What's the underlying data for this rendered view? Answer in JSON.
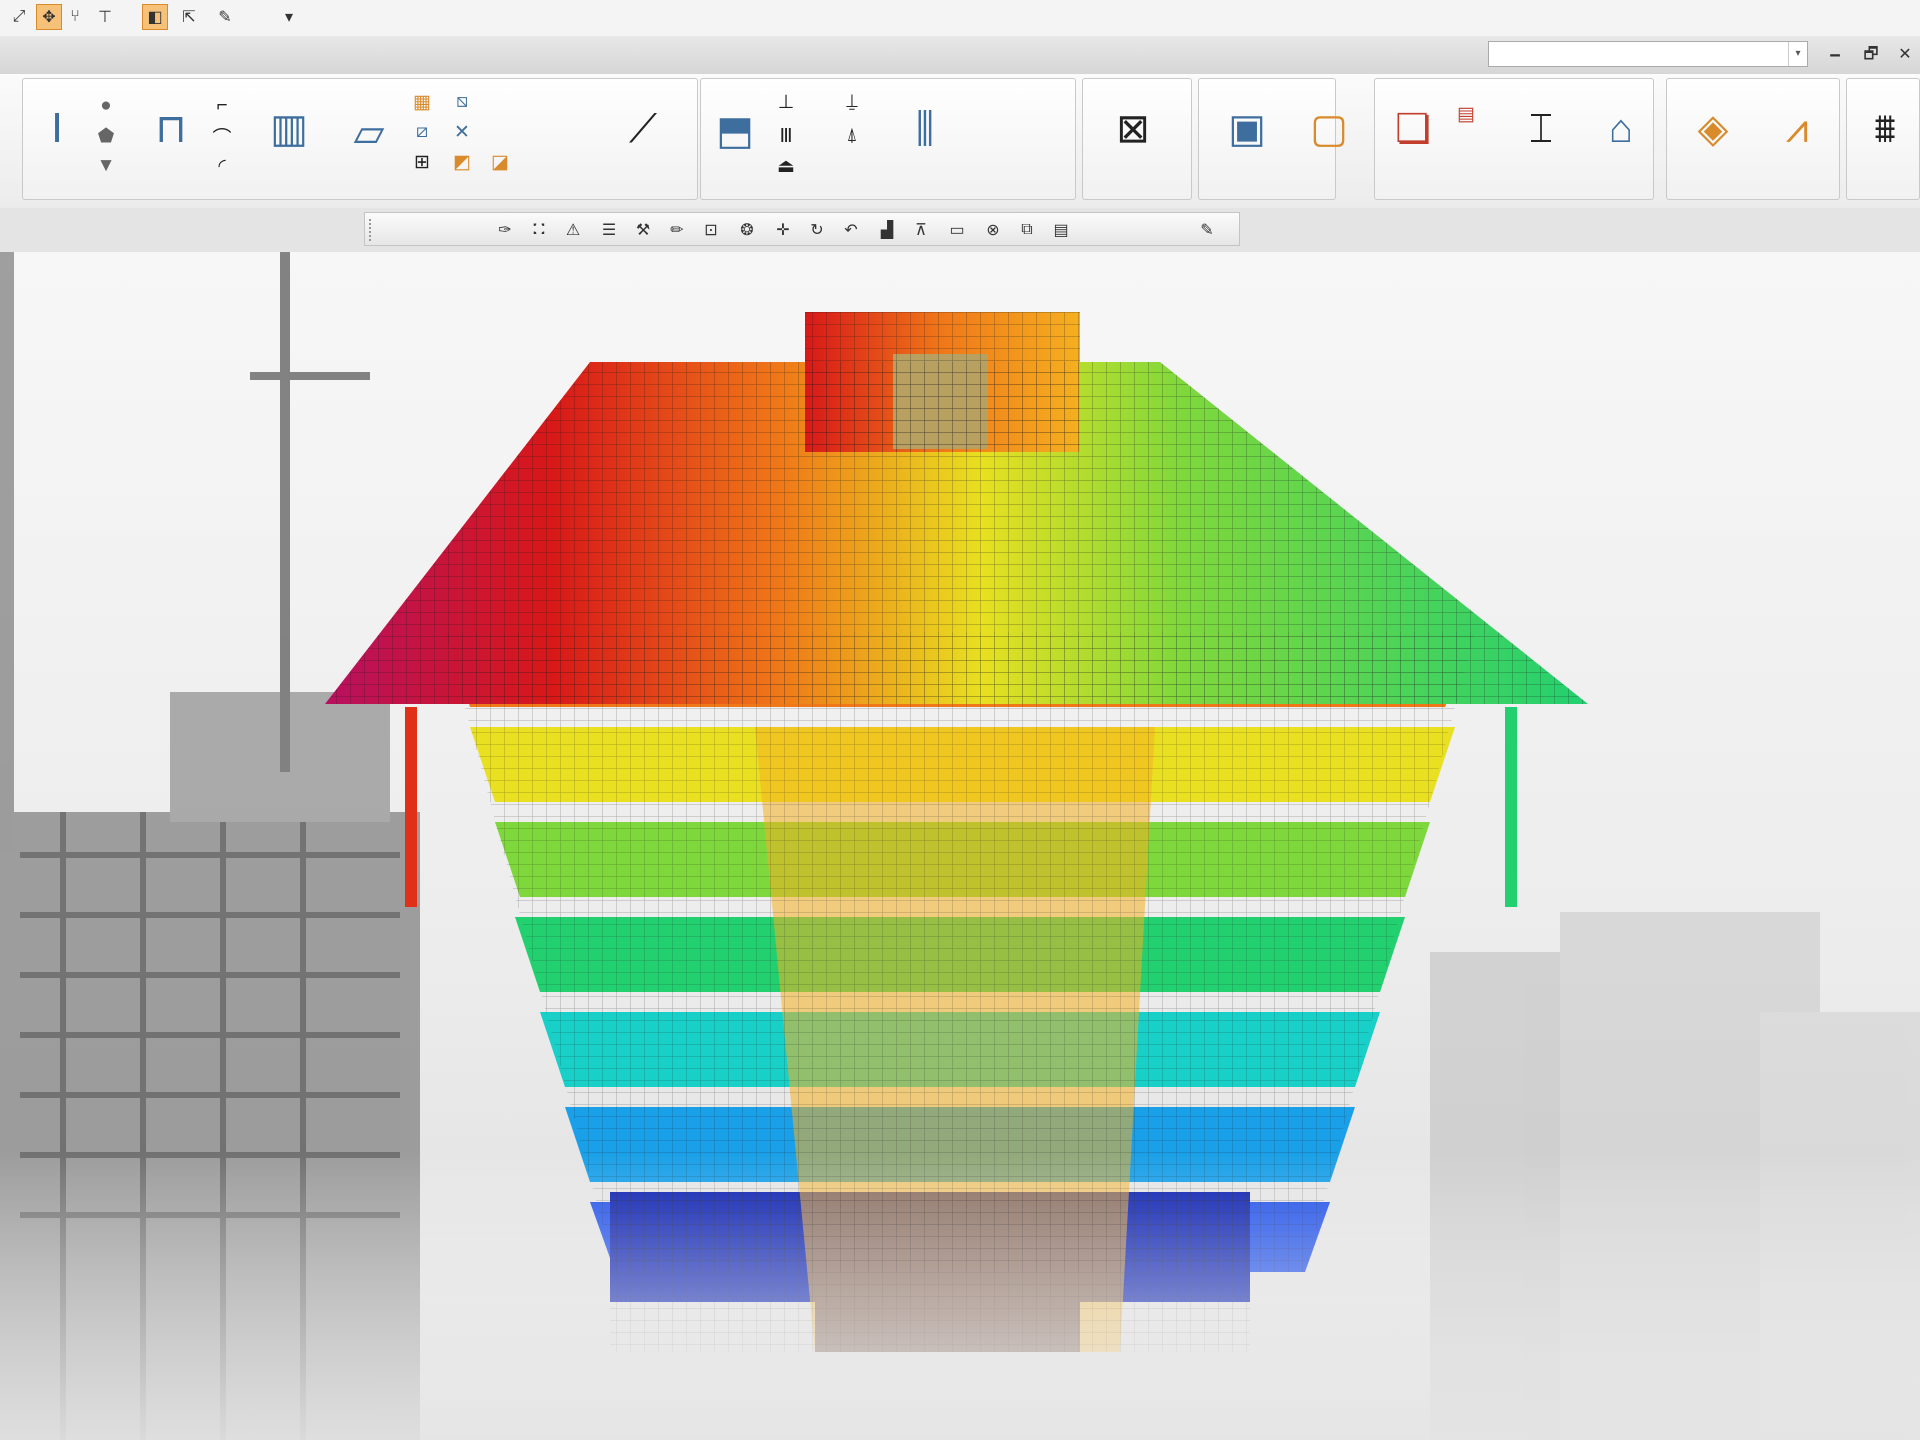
{
  "quick_access": {
    "buttons": [
      {
        "name": "select-icon",
        "glyph": "⤢"
      },
      {
        "name": "pan-icon",
        "glyph": "✥"
      },
      {
        "name": "fork-icon",
        "glyph": "⑂"
      },
      {
        "name": "dimension-icon",
        "glyph": "⊤"
      },
      {
        "name": "node-icon",
        "glyph": "◧"
      },
      {
        "name": "measure-icon",
        "glyph": "⇱"
      },
      {
        "name": "pen-icon",
        "glyph": "✎"
      },
      {
        "name": "more-icon",
        "glyph": "▾"
      }
    ]
  },
  "titlebar": {
    "search_value": "",
    "dropdown_glyph": "▾",
    "window_buttons": [
      {
        "name": "minimize-window-icon",
        "glyph": "🗕"
      },
      {
        "name": "restore-window-icon",
        "glyph": "🗗"
      },
      {
        "name": "close-window-icon",
        "glyph": "✕"
      }
    ]
  },
  "ribbon": {
    "buttons": [
      {
        "name": "column-tool-icon",
        "glyph": "Ⅰ",
        "size": "lg",
        "color": "b"
      },
      {
        "name": "circle-section-icon",
        "glyph": "●",
        "size": "sm",
        "color": "g"
      },
      {
        "name": "tapered-section-icon",
        "glyph": "⬟",
        "size": "sm",
        "color": "g"
      },
      {
        "name": "funnel-section-icon",
        "glyph": "▼",
        "size": "sm",
        "color": "g"
      },
      {
        "name": "beam-frame-icon",
        "glyph": "⊓",
        "size": "lg",
        "color": "b"
      },
      {
        "name": "bracket-icon",
        "glyph": "⌐",
        "size": "sm",
        "color": "k"
      },
      {
        "name": "curved-beam-icon",
        "glyph": "⌒",
        "size": "sm",
        "color": "k"
      },
      {
        "name": "arc-icon",
        "glyph": "◜",
        "size": "sm",
        "color": "k"
      },
      {
        "name": "wall-tool-icon",
        "glyph": "▥",
        "size": "lg",
        "color": "b"
      },
      {
        "name": "slab-tool-icon",
        "glyph": "⏥",
        "size": "lg",
        "color": "b"
      },
      {
        "name": "grid-icon",
        "glyph": "▦",
        "size": "sm",
        "color": "o"
      },
      {
        "name": "opening-icon",
        "glyph": "⧄",
        "size": "sm",
        "color": "b"
      },
      {
        "name": "panel-icon",
        "glyph": "⊞",
        "size": "sm",
        "color": "k"
      },
      {
        "name": "hatch-icon",
        "glyph": "⧅",
        "size": "sm",
        "color": "b"
      },
      {
        "name": "cross-icon",
        "glyph": "✕",
        "size": "sm",
        "color": "b"
      },
      {
        "name": "load-area-icon",
        "glyph": "◩",
        "size": "sm",
        "color": "o"
      },
      {
        "name": "load-panel-icon",
        "glyph": "◪",
        "size": "sm",
        "color": "o"
      },
      {
        "name": "stair-icon",
        "glyph": "⟋",
        "size": "lg",
        "color": "k"
      },
      {
        "name": "foundation-icon",
        "glyph": "⬒",
        "size": "lg",
        "color": "b"
      },
      {
        "name": "support-icon",
        "glyph": "⊥",
        "size": "sm",
        "color": "k"
      },
      {
        "name": "pile-icon",
        "glyph": "Ⅲ",
        "size": "sm",
        "color": "k"
      },
      {
        "name": "pedestal-icon",
        "glyph": "⏏",
        "size": "sm",
        "color": "k"
      },
      {
        "name": "point-support-icon",
        "glyph": "⍊",
        "size": "sm",
        "color": "k"
      },
      {
        "name": "spring-icon",
        "glyph": "⍋",
        "size": "sm",
        "color": "k"
      },
      {
        "name": "column-grid-icon",
        "glyph": "⫼",
        "size": "lg",
        "color": "b"
      },
      {
        "name": "frame-analysis-icon",
        "glyph": "⊠",
        "size": "lg",
        "color": "k"
      },
      {
        "name": "view-window-icon",
        "glyph": "▣",
        "size": "lg",
        "color": "b"
      },
      {
        "name": "view-window-alt-icon",
        "glyph": "▢",
        "size": "lg",
        "color": "o"
      },
      {
        "name": "reports-icon",
        "glyph": "❏",
        "size": "lg",
        "color": "r"
      },
      {
        "name": "report-item-icon",
        "glyph": "▤",
        "size": "sm",
        "color": "r"
      },
      {
        "name": "section-design-icon",
        "glyph": "⌶",
        "size": "lg",
        "color": "k"
      },
      {
        "name": "building-icon",
        "glyph": "⌂",
        "size": "lg",
        "color": "b"
      },
      {
        "name": "render-icon",
        "glyph": "◈",
        "size": "lg",
        "color": "o"
      },
      {
        "name": "truss-icon",
        "glyph": "⩘",
        "size": "lg",
        "color": "o"
      },
      {
        "name": "structure-icon",
        "glyph": "⩩",
        "size": "lg",
        "color": "k"
      }
    ]
  },
  "subtoolbar": {
    "buttons": [
      {
        "name": "pipette-icon",
        "glyph": "✑"
      },
      {
        "name": "paint-icon",
        "glyph": "⛚"
      },
      {
        "name": "warning-icon",
        "glyph": "⚠"
      },
      {
        "name": "list-icon",
        "glyph": "☰"
      },
      {
        "name": "tools-icon",
        "glyph": "⚒"
      },
      {
        "name": "pencil-icon",
        "glyph": "✏"
      },
      {
        "name": "frame-icon",
        "glyph": "⊡"
      },
      {
        "name": "color-wheel-icon",
        "glyph": "❂"
      },
      {
        "name": "move-icon",
        "glyph": "✛"
      },
      {
        "name": "rotate-icon",
        "glyph": "↻"
      },
      {
        "name": "undo-icon",
        "glyph": "↶"
      },
      {
        "name": "chart-icon",
        "glyph": "▟"
      },
      {
        "name": "bridge-icon",
        "glyph": "⊼"
      },
      {
        "name": "window-icon",
        "glyph": "▭"
      },
      {
        "name": "binoculars-icon",
        "glyph": "⊗"
      },
      {
        "name": "split-view-icon",
        "glyph": "⧉"
      },
      {
        "name": "panel-view-icon",
        "glyph": "▤"
      },
      {
        "name": "edit-pen-icon",
        "glyph": "✎"
      }
    ]
  },
  "colors": {
    "contour": [
      "#0a1fb0",
      "#1f4fe8",
      "#1aa0e8",
      "#18d0c8",
      "#22d070",
      "#7ed83c",
      "#e8e020",
      "#f5b020",
      "#f07818",
      "#e03018",
      "#d81818",
      "#b81060"
    ]
  }
}
